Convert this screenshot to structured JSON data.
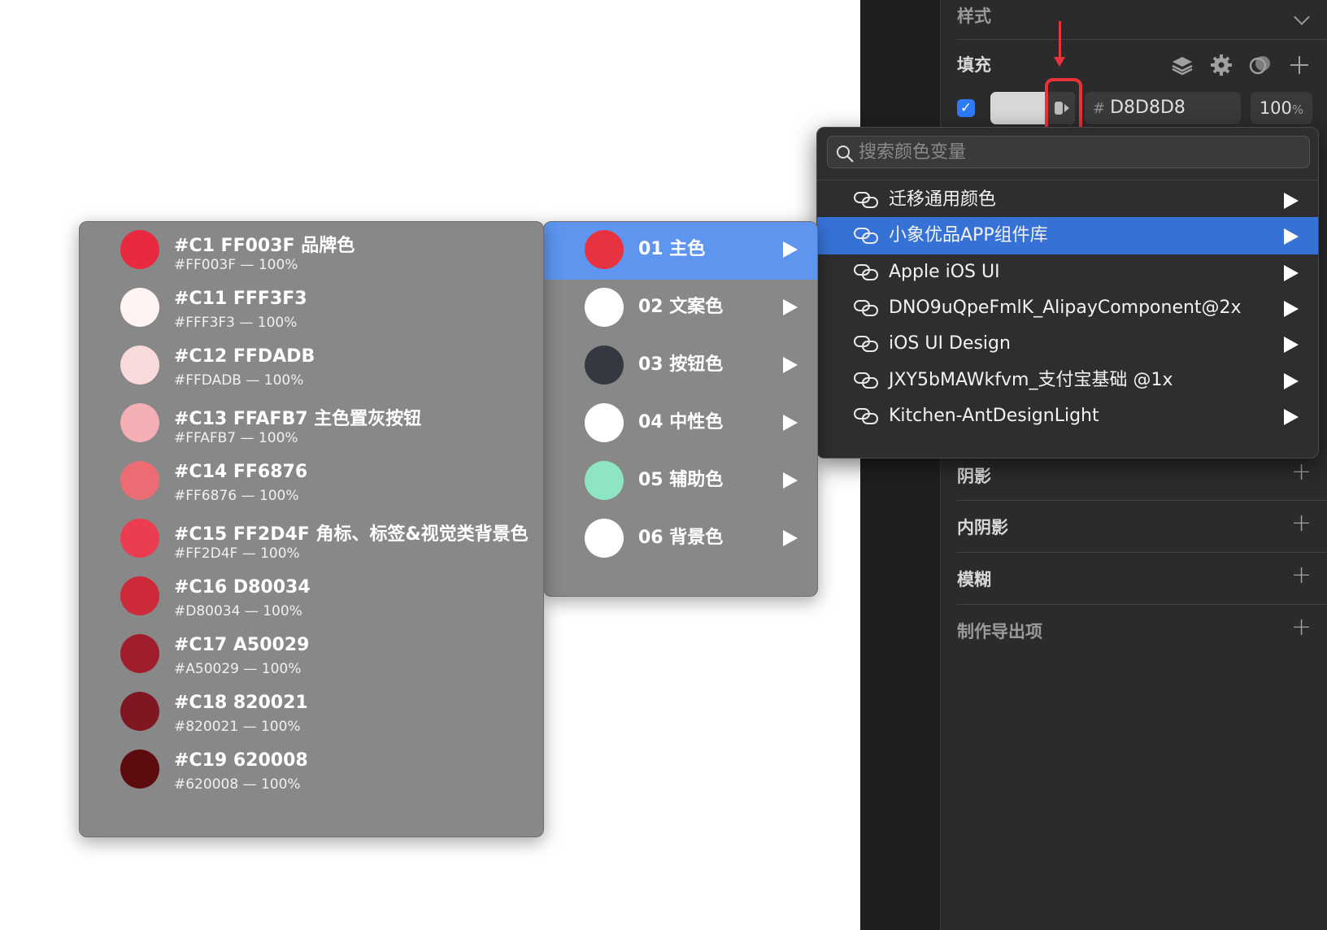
{
  "inspector": {
    "style_title": "样式",
    "fill_title": "填充",
    "fill_enabled": true,
    "fill_swatch_color": "#D8D8D8",
    "hex_prefix": "#",
    "hex_value": "D8D8D8",
    "opacity_value": "100",
    "opacity_unit": "%",
    "shadow_title": "阴影",
    "inner_shadow_title": "内阴影",
    "blur_title": "模糊",
    "export_title": "制作导出项"
  },
  "variable_menu": {
    "search_placeholder": "搜索颜色变量",
    "items": [
      {
        "label": "迁移通用颜色",
        "active": false
      },
      {
        "label": "小象优品APP组件库",
        "active": true
      },
      {
        "label": "Apple iOS UI",
        "active": false
      },
      {
        "label": "DNO9uQpeFmlK_AlipayComponent@2x",
        "active": false
      },
      {
        "label": "iOS UI Design",
        "active": false
      },
      {
        "label": "JXY5bMAWkfvm_支付宝基础 @1x",
        "active": false
      },
      {
        "label": "Kitchen-AntDesignLight",
        "active": false
      }
    ]
  },
  "category_menu": {
    "items": [
      {
        "label": "01 主色",
        "color": "#E8323F",
        "active": true
      },
      {
        "label": "02 文案色",
        "color": "#FFFFFF",
        "active": false
      },
      {
        "label": "03 按钮色",
        "color": "#343840",
        "active": false
      },
      {
        "label": "04 中性色",
        "color": "#FFFFFF",
        "active": false
      },
      {
        "label": "05 辅助色",
        "color": "#8EE5C2",
        "active": false
      },
      {
        "label": "06 背景色",
        "color": "#FFFFFF",
        "active": false
      }
    ]
  },
  "color_menu": {
    "items": [
      {
        "name": "#C1 FF003F 品牌色",
        "detail": "#FF003F — 100%",
        "color": "#E9293F"
      },
      {
        "name": "#C11 FFF3F3",
        "detail": "#FFF3F3 — 100%",
        "color": "#FFF3F3"
      },
      {
        "name": "#C12 FFDADB",
        "detail": "#FFDADB — 100%",
        "color": "#F8DADB"
      },
      {
        "name": "#C13 FFAFB7  主色置灰按钮",
        "detail": "#FFAFB7 — 100%",
        "color": "#F4AFB5"
      },
      {
        "name": "#C14 FF6876",
        "detail": "#FF6876 — 100%",
        "color": "#EC6C74"
      },
      {
        "name": "#C15 FF2D4F 角标、标签&视觉类背景色",
        "detail": "#FF2D4F — 100%",
        "color": "#EC3C4F"
      },
      {
        "name": "#C16 D80034",
        "detail": "#D80034 — 100%",
        "color": "#CC2A38"
      },
      {
        "name": "#C17 A50029",
        "detail": "#A50029 — 100%",
        "color": "#A01E2C"
      },
      {
        "name": "#C18 820021",
        "detail": "#820021 — 100%",
        "color": "#7E1722"
      },
      {
        "name": "#C19 620008",
        "detail": "#620008 — 100%",
        "color": "#5E0B0F"
      }
    ]
  },
  "colors": {
    "accent_blue": "#3672D6",
    "highlight_red": "#E8333A"
  }
}
